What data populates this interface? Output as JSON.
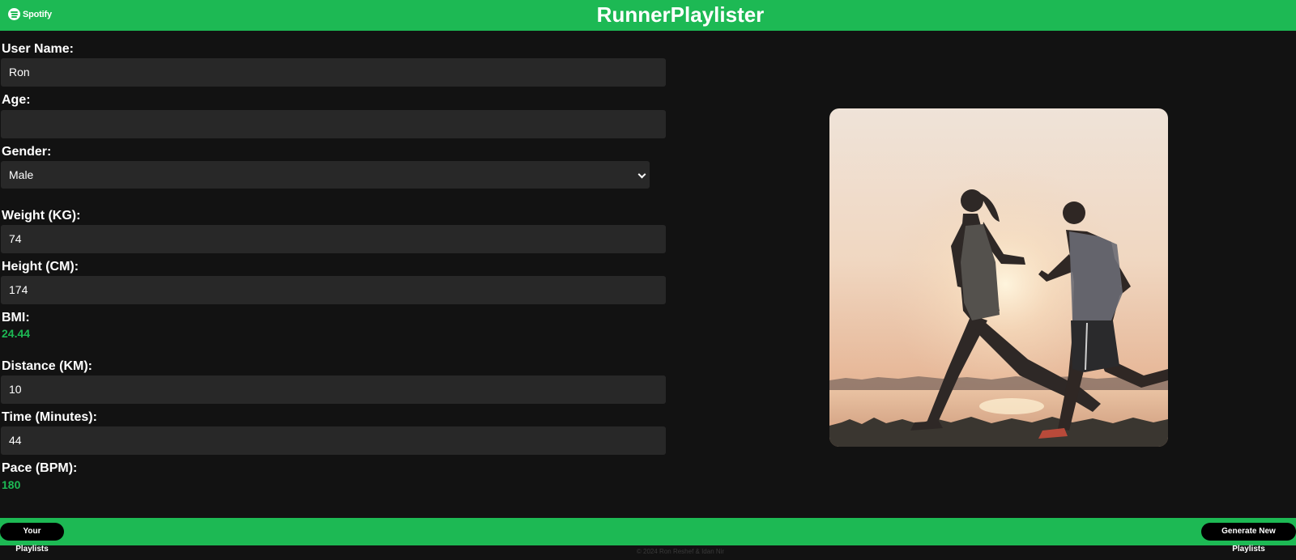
{
  "header": {
    "brand": "Spotify",
    "title": "RunnerPlaylister"
  },
  "form": {
    "username": {
      "label": "User Name:",
      "value": "Ron"
    },
    "age": {
      "label": "Age:",
      "value": ""
    },
    "gender": {
      "label": "Gender:",
      "selected": "Male"
    },
    "weight": {
      "label": "Weight (KG):",
      "value": "74"
    },
    "height": {
      "label": "Height (CM):",
      "value": "174"
    },
    "bmi": {
      "label": "BMI:",
      "value": "24.44"
    },
    "distance": {
      "label": "Distance (KM):",
      "value": "10"
    },
    "time": {
      "label": "Time (Minutes):",
      "value": "44"
    },
    "pace": {
      "label": "Pace (BPM):",
      "value": "180"
    }
  },
  "footer": {
    "left_button": "Your Playlists",
    "right_button": "Generate New Playlists",
    "copyright": "© 2024 Ron Reshef & Idan Nir"
  },
  "colors": {
    "accent": "#1db954",
    "background": "#121212",
    "field": "#282828"
  },
  "icons": [
    "spotify-logo-icon",
    "chevron-down-icon"
  ],
  "image": "runners-at-sunset-photo"
}
